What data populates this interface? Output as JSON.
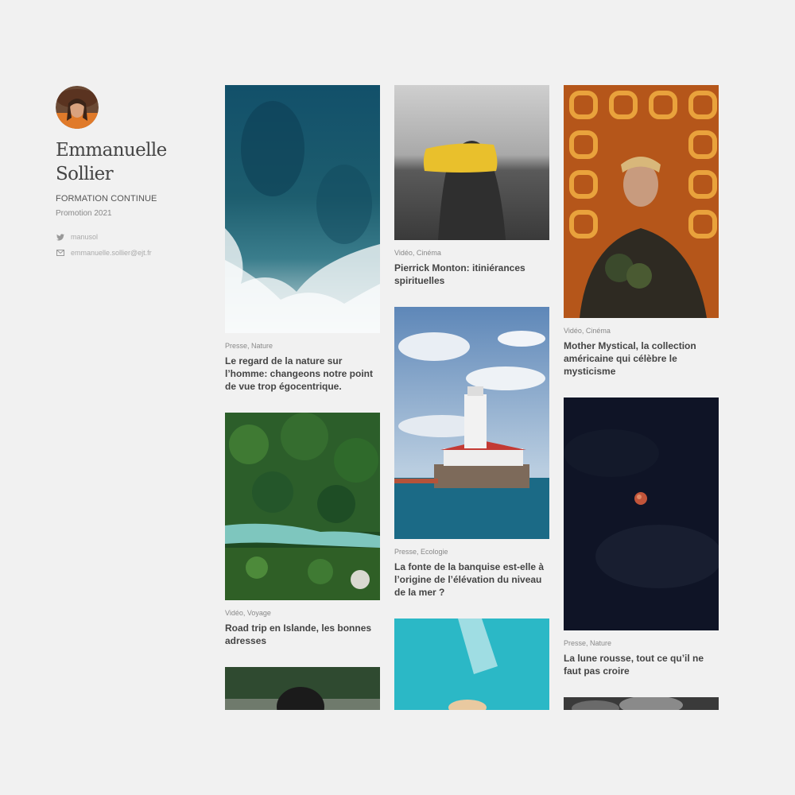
{
  "profile": {
    "name": "Emmanuelle Sollier",
    "program": "FORMATION CONTINUE",
    "promotion": "Promotion 2021",
    "twitter": "manusol",
    "email": "emmanuelle.sollier@ejt.fr"
  },
  "cards": [
    {
      "category": "Presse, Nature",
      "title": "Le regard de la nature sur l’homme: changeons notre point de vue trop égocentrique."
    },
    {
      "category": "Vidéo, Voyage",
      "title": "Road trip en Islande, les bonnes adresses"
    },
    {
      "category": "",
      "title": ""
    },
    {
      "category": "Vidéo, Cinéma",
      "title": "Pierrick Monton: itiniérances spirituelles"
    },
    {
      "category": "Presse, Ecologie",
      "title": "La fonte de la banquise est-elle à l’origine de l’élévation du niveau de la mer ?"
    },
    {
      "category": "",
      "title": ""
    },
    {
      "category": "Vidéo, Cinéma",
      "title": "Mother Mystical, la collection américaine qui célèbre le mysticisme"
    },
    {
      "category": "Presse, Nature",
      "title": "La lune rousse, tout ce qu’il ne faut pas croire"
    },
    {
      "category": "",
      "title": ""
    }
  ],
  "icons": {
    "twitter": "twitter-icon",
    "email": "mail-icon"
  }
}
